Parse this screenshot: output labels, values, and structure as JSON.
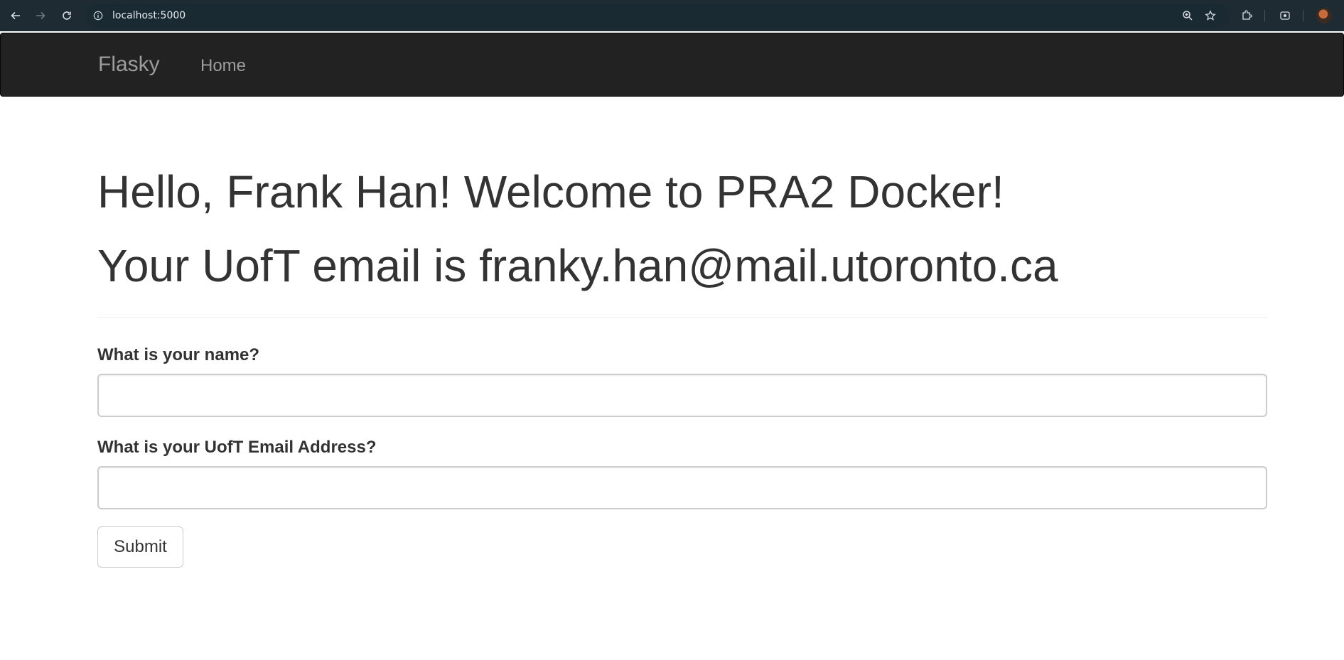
{
  "browser": {
    "url": "localhost:5000"
  },
  "navbar": {
    "brand": "Flasky",
    "items": [
      {
        "label": "Home"
      }
    ]
  },
  "main": {
    "greeting": "Hello, Frank Han! Welcome to PRA2 Docker!",
    "email_line": "Your UofT email is franky.han@mail.utoronto.ca"
  },
  "form": {
    "name_label": "What is your name?",
    "name_value": "",
    "email_label": "What is your UofT Email Address?",
    "email_value": "",
    "submit_label": "Submit"
  },
  "colors": {
    "navbar_bg": "#222222",
    "navbar_text": "#9d9d9d",
    "browser_bar": "#1f2b33"
  }
}
